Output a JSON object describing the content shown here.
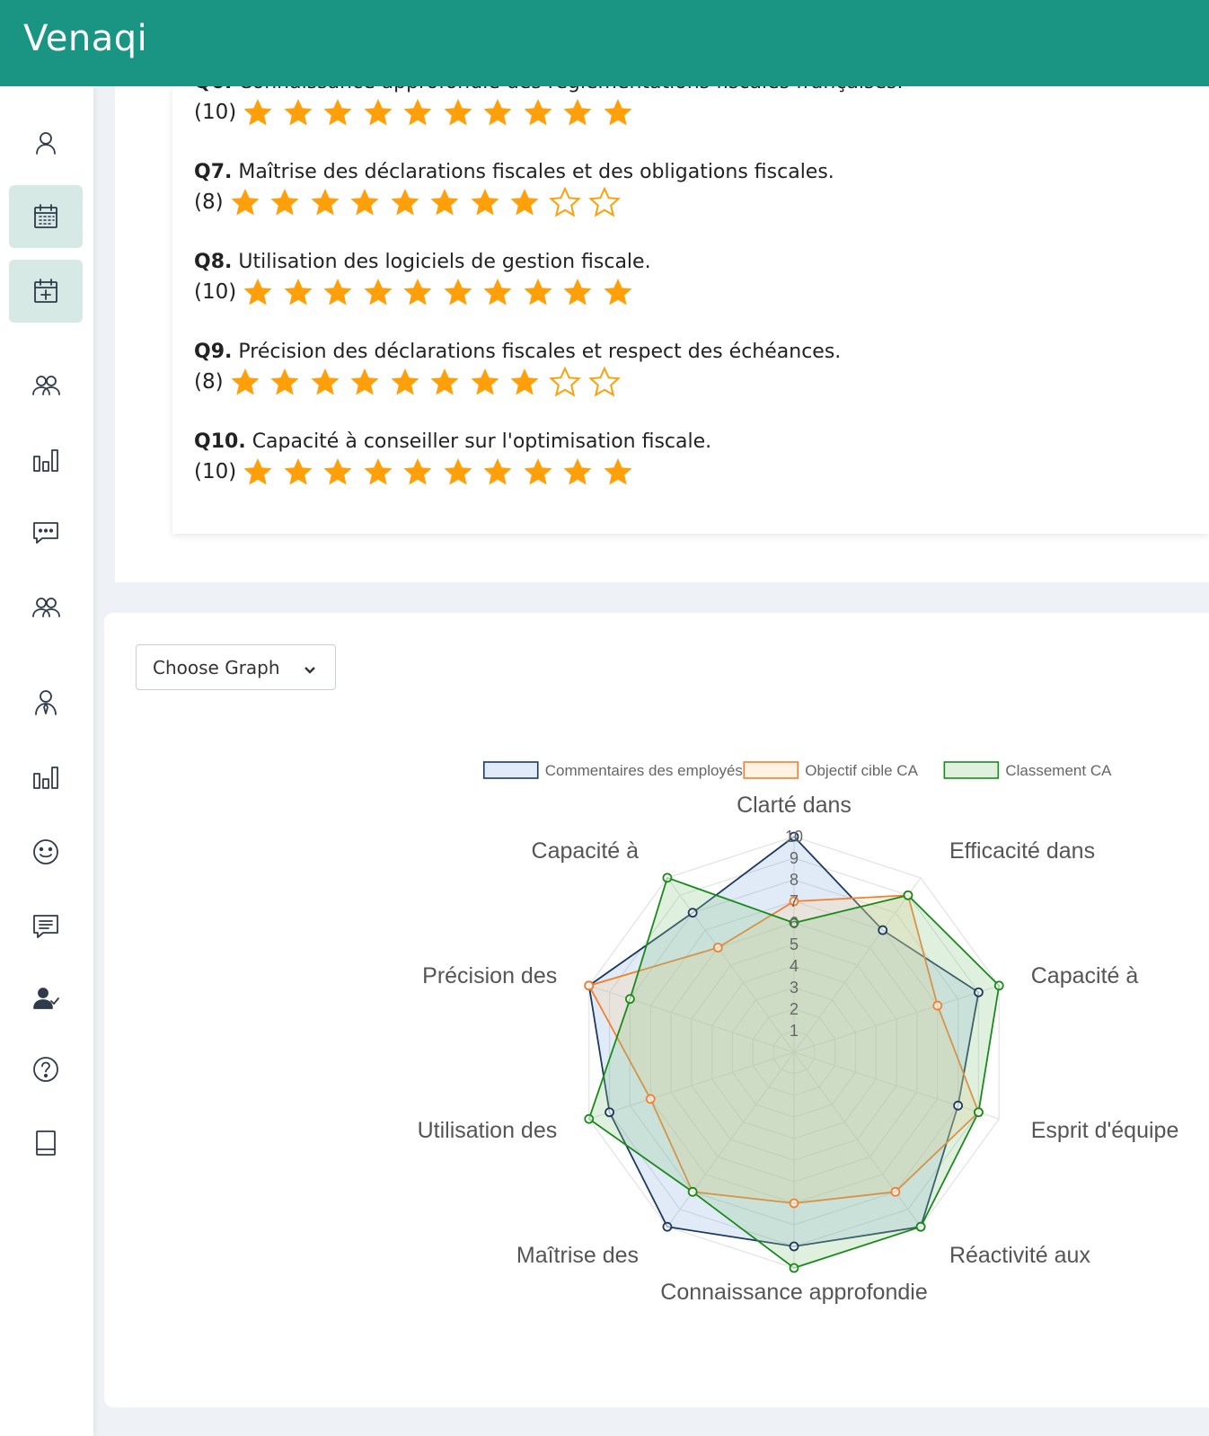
{
  "app": {
    "brand": "Venaqi"
  },
  "sidebar": {
    "items": [
      {
        "icon": "user-icon",
        "active": false
      },
      {
        "icon": "calendar-icon",
        "active": true
      },
      {
        "icon": "calendar-plus-icon",
        "active": true
      },
      {
        "icon": "users-icon",
        "active": false
      },
      {
        "icon": "bar-chart-icon",
        "active": false
      },
      {
        "icon": "chat-dots-icon",
        "active": false
      },
      {
        "icon": "users-icon",
        "active": false
      },
      {
        "icon": "user-tie-icon",
        "active": false
      },
      {
        "icon": "bar-chart-icon",
        "active": false
      },
      {
        "icon": "smiley-icon",
        "active": false
      },
      {
        "icon": "message-lines-icon",
        "active": false
      },
      {
        "icon": "user-check-icon",
        "active": false
      },
      {
        "icon": "help-circle-icon",
        "active": false
      },
      {
        "icon": "book-icon",
        "active": false
      }
    ]
  },
  "questions": [
    {
      "num": "Q6.",
      "text": "Connaissance approfondie des réglementations fiscales françaises.",
      "rating_label": "(10)",
      "rating": 10,
      "max": 10
    },
    {
      "num": "Q7.",
      "text": "Maîtrise des déclarations fiscales et des obligations fiscales.",
      "rating_label": "(8)",
      "rating": 8,
      "max": 10
    },
    {
      "num": "Q8.",
      "text": "Utilisation des logiciels de gestion fiscale.",
      "rating_label": "(10)",
      "rating": 10,
      "max": 10
    },
    {
      "num": "Q9.",
      "text": "Précision des déclarations fiscales et respect des échéances.",
      "rating_label": "(8)",
      "rating": 8,
      "max": 10
    },
    {
      "num": "Q10.",
      "text": "Capacité à conseiller sur l'optimisation fiscale.",
      "rating_label": "(10)",
      "rating": 10,
      "max": 10
    }
  ],
  "colors": {
    "accent": "#1a9584",
    "star": "#ff9f0a"
  },
  "graph_select": {
    "label": "Choose Graph"
  },
  "chart_data": {
    "type": "radar",
    "labels": [
      "Clarté dans",
      "Efficacité dans",
      "Capacité à",
      "Esprit d'équipe",
      "Réactivité aux",
      "Connaissance approfondie",
      "Maîtrise des",
      "Utilisation des",
      "Précision des",
      "Capacité à"
    ],
    "ticks": [
      "1",
      "2",
      "3",
      "4",
      "5",
      "6",
      "7",
      "8",
      "9",
      "10"
    ],
    "rlim": [
      0,
      10
    ],
    "legend_position": "top",
    "series": [
      {
        "name": "Commentaires des employés",
        "color": "#1c3a5e",
        "fill": "rgba(120,160,220,0.22)",
        "values": [
          10,
          7,
          9,
          8,
          10,
          9,
          10,
          9,
          10,
          8
        ]
      },
      {
        "name": "Objectif cible CA",
        "color": "#f08030",
        "fill": "rgba(250,210,150,0.28)",
        "values": [
          7,
          9,
          7,
          9,
          8,
          7,
          8,
          7,
          10,
          6
        ]
      },
      {
        "name": "Classement CA",
        "color": "#1a8a1a",
        "fill": "rgba(140,200,140,0.28)",
        "values": [
          6,
          9,
          10,
          9,
          10,
          10,
          8,
          10,
          8,
          10
        ]
      }
    ]
  }
}
